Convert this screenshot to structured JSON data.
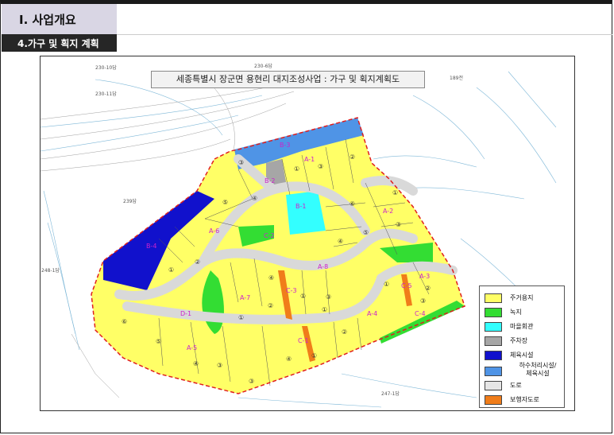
{
  "header": {
    "section_title": "Ⅰ. 사업개요",
    "sub_title": "4.가구 및 획지 계획"
  },
  "map": {
    "title": "세종특별시 장군면 용현리 대지조성사업 : 가구 및 획지계획도",
    "blocks": {
      "A1": "A-1",
      "A2": "A-2",
      "A3": "A-3",
      "A4": "A-4",
      "A5": "A-5",
      "A6": "A-6",
      "A7": "A-7",
      "A8": "A-8",
      "B1": "B-1",
      "B2": "B-2",
      "B3": "B-3",
      "B4": "B-4",
      "C1": "C-1",
      "C2": "C-2",
      "C3": "C-3",
      "C4": "C-4",
      "C5": "C-5",
      "D1": "D-1"
    },
    "lot_numbers": [
      "①",
      "②",
      "③",
      "④",
      "⑤",
      "⑥"
    ],
    "parcel_labels": {
      "p230_10": "230-10답",
      "p230_11": "230-11답",
      "p239": "239답",
      "p248_1": "248-1답",
      "p189": "189전",
      "p230_6": "230-6답",
      "p247_1": "247-1답"
    }
  },
  "legend": {
    "items": [
      {
        "label": "주거용지",
        "color": "#ffff66"
      },
      {
        "label": "녹지",
        "color": "#33dd33"
      },
      {
        "label": "마을회관",
        "color": "#33ffff"
      },
      {
        "label": "주차장",
        "color": "#a6a6a6"
      },
      {
        "label": "체육시설",
        "color": "#1111cc"
      },
      {
        "label": "하수처리시설/\n체육시설",
        "color": "#4f94e6"
      },
      {
        "label": "도로",
        "color": "#e6e6e6"
      },
      {
        "label": "보행자도로",
        "color": "#f07d1a"
      }
    ]
  }
}
